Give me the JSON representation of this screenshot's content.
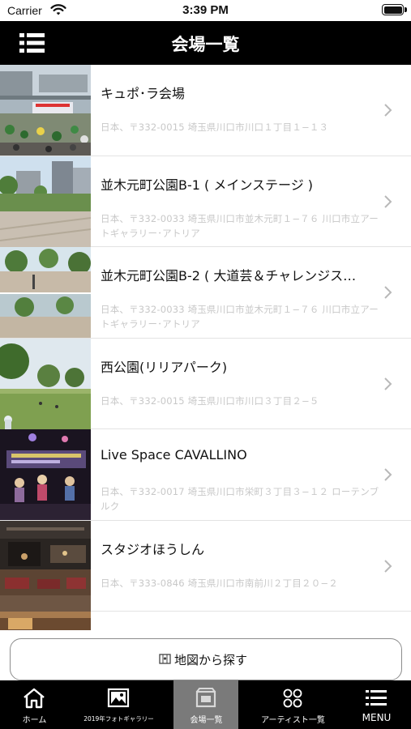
{
  "status_bar": {
    "carrier": "Carrier",
    "time": "3:39 PM"
  },
  "nav": {
    "title": "会場一覧",
    "menu_icon": "list-menu-icon"
  },
  "venues": [
    {
      "name": "キュポ･ラ会場",
      "address": "日本、〒332-0015 埼玉県川口市川口１丁目１−１３"
    },
    {
      "name": "並木元町公園B-1 ( メインステージ )",
      "address": "日本、〒332-0033 埼玉県川口市並木元町１−７６ 川口市立アートギャラリー･アトリア"
    },
    {
      "name": "並木元町公園B-2 ( 大道芸＆チャレンジス…",
      "address": "日本、〒332-0033 埼玉県川口市並木元町１−７６ 川口市立アートギャラリー･アトリア"
    },
    {
      "name": "西公園(リリアパーク)",
      "address": "日本、〒332-0015 埼玉県川口市川口３丁目２−５"
    },
    {
      "name": "Live Space CAVALLINO",
      "address": "日本、〒332-0017 埼玉県川口市栄町３丁目３−１２ ローテンブルク"
    },
    {
      "name": "スタジオほうしん",
      "address": "日本、〒333-0846 埼玉県川口市南前川２丁目２０−２"
    }
  ],
  "map_button": {
    "label": "地図から探す",
    "icon": "map-icon"
  },
  "tabs": [
    {
      "label": "ホーム",
      "icon": "home-icon",
      "active": false
    },
    {
      "label": "2019年フォトギャラリー",
      "icon": "photo-gallery-icon",
      "active": false
    },
    {
      "label": "会場一覧",
      "icon": "venue-icon",
      "active": true
    },
    {
      "label": "アーティスト一覧",
      "icon": "artists-icon",
      "active": false
    },
    {
      "label": "MENU",
      "icon": "menu-icon",
      "active": false
    }
  ],
  "colors": {
    "nav_background": "#000000",
    "tab_active": "#7a7a7a",
    "address_text": "#c8c8c8"
  }
}
